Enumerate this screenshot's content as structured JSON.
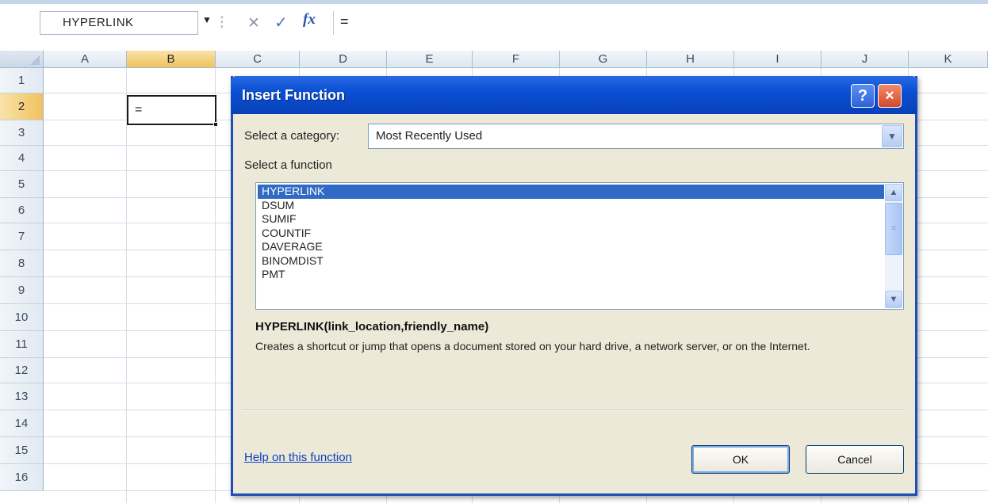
{
  "formula_bar": {
    "name_box": "HYPERLINK",
    "formula": "=",
    "icons": [
      "dropdown-arrow-icon",
      "cancel-x-icon",
      "enter-check-icon",
      "insert-function-fx-icon"
    ]
  },
  "sheet": {
    "columns": [
      "A",
      "B",
      "C",
      "D",
      "E",
      "F",
      "G",
      "H",
      "I",
      "J",
      "K"
    ],
    "selected_column": "B",
    "rows": [
      "1",
      "2",
      "3",
      "4",
      "5",
      "6",
      "7",
      "8",
      "9",
      "10",
      "11",
      "12",
      "13",
      "14",
      "15",
      "16"
    ],
    "selected_row": "2",
    "active_cell_value": "="
  },
  "dialog": {
    "title": "Insert Function",
    "help_glyph": "?",
    "close_glyph": "×",
    "category_label": "Select a category:",
    "category_value": "Most Recently Used",
    "function_label": "Select a function",
    "functions": [
      "HYPERLINK",
      "DSUM",
      "SUMIF",
      "COUNTIF",
      "DAVERAGE",
      "BINOMDIST",
      "PMT"
    ],
    "selected_function": "HYPERLINK",
    "signature": "HYPERLINK(link_location,friendly_name)",
    "description": "Creates a shortcut or jump that opens a document stored on your hard drive, a network server, or on the Internet.",
    "help_link": "Help on this function",
    "ok_label": "OK",
    "cancel_label": "Cancel"
  }
}
